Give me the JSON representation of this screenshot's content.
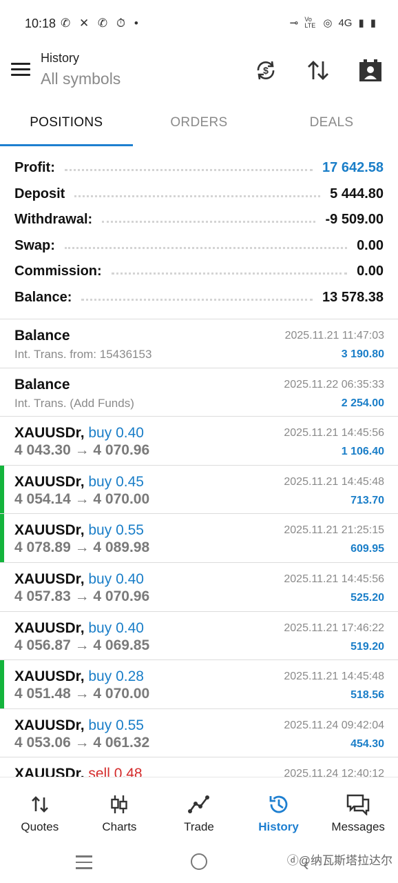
{
  "status_bar": {
    "time": "10:18",
    "left_icons": "✆ ✕ ✆ ⏱ •",
    "right_icons": [
      "⊸",
      "Vo LTE",
      "◎",
      "4G",
      "▮",
      "▮"
    ]
  },
  "header": {
    "title": "History",
    "subtitle": "All symbols"
  },
  "tabs": [
    {
      "label": "POSITIONS",
      "active": true
    },
    {
      "label": "ORDERS",
      "active": false
    },
    {
      "label": "DEALS",
      "active": false
    }
  ],
  "summary": {
    "profit": {
      "label": "Profit:",
      "value": "17 642.58"
    },
    "deposit": {
      "label": "Deposit",
      "value": "5 444.80"
    },
    "withdrawal": {
      "label": "Withdrawal:",
      "value": "-9 509.00"
    },
    "swap": {
      "label": "Swap:",
      "value": "0.00"
    },
    "commission": {
      "label": "Commission:",
      "value": "0.00"
    },
    "balance": {
      "label": "Balance:",
      "value": "13 578.38"
    }
  },
  "deals": [
    {
      "title": "Balance",
      "subtitle": "Int. Trans. from: 15436153",
      "time": "2025.11.21 11:47:03",
      "profit": "3 190.80"
    },
    {
      "title": "Balance",
      "subtitle": "Int. Trans. (Add Funds)",
      "time": "2025.11.22 06:35:33",
      "profit": "2 254.00"
    },
    {
      "symbol": "XAUUSDr,",
      "type": "buy 0.40",
      "prices": "4 043.30 → 4 070.96",
      "time": "2025.11.21 14:45:56",
      "profit": "1 106.40",
      "marker": false
    },
    {
      "symbol": "XAUUSDr,",
      "type": "buy 0.45",
      "prices": "4 054.14 → 4 070.00",
      "time": "2025.11.21 14:45:48",
      "profit": "713.70",
      "marker": true
    },
    {
      "symbol": "XAUUSDr,",
      "type": "buy 0.55",
      "prices": "4 078.89 → 4 089.98",
      "time": "2025.11.21 21:25:15",
      "profit": "609.95",
      "marker": true
    },
    {
      "symbol": "XAUUSDr,",
      "type": "buy 0.40",
      "prices": "4 057.83 → 4 070.96",
      "time": "2025.11.21 14:45:56",
      "profit": "525.20",
      "marker": false
    },
    {
      "symbol": "XAUUSDr,",
      "type": "buy 0.40",
      "prices": "4 056.87 → 4 069.85",
      "time": "2025.11.21 17:46:22",
      "profit": "519.20",
      "marker": false
    },
    {
      "symbol": "XAUUSDr,",
      "type": "buy 0.28",
      "prices": "4 051.48 → 4 070.00",
      "time": "2025.11.21 14:45:48",
      "profit": "518.56",
      "marker": true
    },
    {
      "symbol": "XAUUSDr,",
      "type": "buy 0.55",
      "prices": "4 053.06 → 4 061.32",
      "time": "2025.11.24 09:42:04",
      "profit": "454.30",
      "marker": false
    },
    {
      "symbol": "XAUUSDr,",
      "type": "sell 0.48",
      "prices": "",
      "time": "2025.11.24 12:40:12",
      "profit": "",
      "marker": false
    }
  ],
  "bottom_nav": [
    {
      "label": "Quotes",
      "icon": "quotes-icon",
      "active": false
    },
    {
      "label": "Charts",
      "icon": "charts-icon",
      "active": false
    },
    {
      "label": "Trade",
      "icon": "trade-icon",
      "active": false
    },
    {
      "label": "History",
      "icon": "history-icon",
      "active": true
    },
    {
      "label": "Messages",
      "icon": "messages-icon",
      "active": false
    }
  ],
  "watermark": "ⓓ@纳瓦斯塔拉达尔",
  "colors": {
    "accent": "#1e7fd0",
    "profit_blue": "#1a7ec8",
    "sell_red": "#d42c2c",
    "marker_green": "#14b43c"
  }
}
